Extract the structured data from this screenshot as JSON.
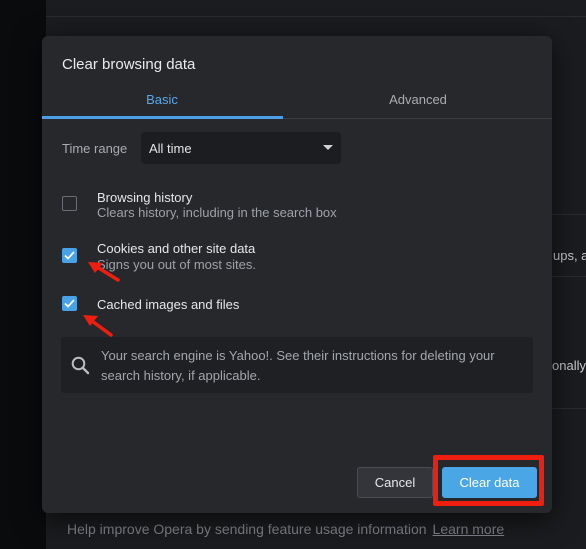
{
  "background": {
    "cutoff_texts": [
      "ups, a",
      "onally"
    ],
    "footer_text": "Help improve Opera by sending feature usage information",
    "footer_link": "Learn more"
  },
  "dialog": {
    "title": "Clear browsing data",
    "tabs": [
      {
        "label": "Basic",
        "active": true
      },
      {
        "label": "Advanced",
        "active": false
      }
    ],
    "time_range": {
      "label": "Time range",
      "value": "All time"
    },
    "options": [
      {
        "title": "Browsing history",
        "description": "Clears history, including in the search box",
        "checked": false
      },
      {
        "title": "Cookies and other site data",
        "description": "Signs you out of most sites.",
        "checked": true
      },
      {
        "title": "Cached images and files",
        "description": "",
        "checked": true
      }
    ],
    "info": "Your search engine is Yahoo!. See their instructions for deleting your search history, if applicable.",
    "buttons": {
      "cancel": "Cancel",
      "clear": "Clear data"
    }
  },
  "colors": {
    "accent": "#4aa6e4",
    "annotation": "#f01e0f",
    "dialog_bg": "#27282c",
    "page_bg": "#1b1c1f"
  },
  "icons": [
    "chevron-down-icon",
    "checkmark-icon",
    "search-icon",
    "annotation-arrow"
  ]
}
